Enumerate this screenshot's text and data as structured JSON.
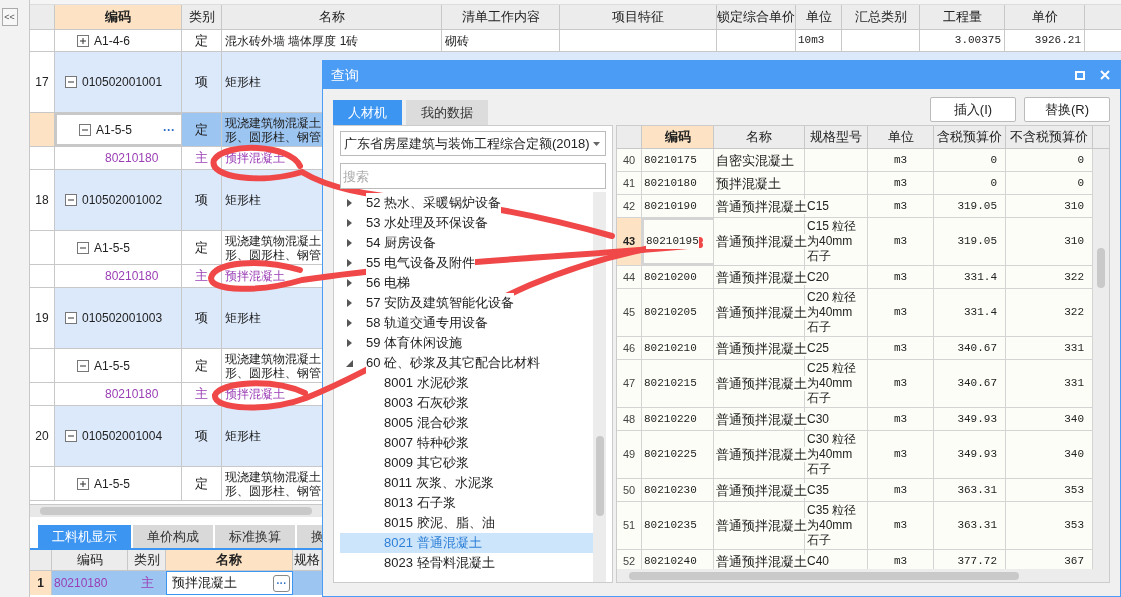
{
  "sidebar_toggle": "<<",
  "main_table": {
    "columns": [
      {
        "label": "编码",
        "selected": true
      },
      {
        "label": "类别",
        "selected": false
      },
      {
        "label": "名称",
        "selected": false
      },
      {
        "label": "清单工作内容",
        "selected": false
      },
      {
        "label": "项目特征",
        "selected": false
      },
      {
        "label": "锁定综合单价",
        "selected": false
      },
      {
        "label": "单位",
        "selected": false
      },
      {
        "label": "汇总类别",
        "selected": false
      },
      {
        "label": "工程量",
        "selected": false
      },
      {
        "label": "单价",
        "selected": false
      }
    ],
    "top_row": {
      "code": "A1-4-6",
      "expanded": false,
      "type": "定",
      "name": "混水砖外墙 墙体厚度 1砖",
      "work": "砌砖",
      "unit": "10m3",
      "quantity": "3.00375",
      "price": "3926.21"
    },
    "rows": [
      {
        "num": "17",
        "code": "010502001001",
        "kind": "bill",
        "expanded": true,
        "type": "项",
        "name": [
          "矩形柱"
        ],
        "selected": false,
        "children": [
          {
            "code": "A1-5-5",
            "kind": "quota",
            "expanded": true,
            "type": "定",
            "name": [
              "现浇建筑物混凝土",
              "形、圆形柱、钢管"
            ],
            "selected": true,
            "more": "···",
            "children": [
              {
                "code": "80210180",
                "kind": "material",
                "type": "主",
                "name": [
                  "预拌混凝土"
                ],
                "selected": false
              }
            ]
          }
        ]
      },
      {
        "num": "18",
        "code": "010502001002",
        "kind": "bill",
        "expanded": true,
        "type": "项",
        "name": [
          "矩形柱"
        ],
        "selected": false,
        "children": [
          {
            "code": "A1-5-5",
            "kind": "quota",
            "expanded": true,
            "type": "定",
            "name": [
              "现浇建筑物混凝土",
              "形、圆形柱、钢管"
            ],
            "selected": false,
            "children": [
              {
                "code": "80210180",
                "kind": "material",
                "type": "主",
                "name": [
                  "预拌混凝土"
                ],
                "selected": false
              }
            ]
          }
        ]
      },
      {
        "num": "19",
        "code": "010502001003",
        "kind": "bill",
        "expanded": true,
        "type": "项",
        "name": [
          "矩形柱"
        ],
        "selected": false,
        "children": [
          {
            "code": "A1-5-5",
            "kind": "quota",
            "expanded": true,
            "type": "定",
            "name": [
              "现浇建筑物混凝土",
              "形、圆形柱、钢管"
            ],
            "selected": false,
            "children": [
              {
                "code": "80210180",
                "kind": "material",
                "type": "主",
                "name": [
                  "预拌混凝土"
                ],
                "selected": false
              }
            ]
          }
        ]
      },
      {
        "num": "20",
        "code": "010502001004",
        "kind": "bill",
        "expanded": true,
        "type": "项",
        "name": [
          "矩形柱"
        ],
        "selected": false,
        "children": [
          {
            "code": "A1-5-5",
            "kind": "quota",
            "expanded": false,
            "type": "定",
            "name": [
              "现浇建筑物混凝土",
              "形、圆形柱、钢管"
            ],
            "selected": false
          }
        ]
      }
    ]
  },
  "detail_tabs": [
    {
      "label": "工料机显示",
      "selected": true
    },
    {
      "label": "单价构成",
      "selected": false
    },
    {
      "label": "标准换算",
      "selected": false
    },
    {
      "label": "换",
      "selected": false
    }
  ],
  "detail_table": {
    "columns": [
      {
        "label": "编码",
        "selected": false
      },
      {
        "label": "类别",
        "selected": false
      },
      {
        "label": "名称",
        "selected": true
      },
      {
        "label": "规格",
        "selected": false
      }
    ],
    "rows": [
      {
        "num": "1",
        "code": "80210180",
        "type": "主",
        "name": "预拌混凝土",
        "more": "···",
        "selected": true
      }
    ]
  },
  "dialog": {
    "title": "查询",
    "tabs": [
      {
        "label": "人材机",
        "selected": true
      },
      {
        "label": "我的数据",
        "selected": false
      }
    ],
    "buttons": [
      "插入(I)",
      "替换(R)"
    ],
    "quota_book": "广东省房屋建筑与装饰工程综合定额(2018)",
    "search_placeholder": "搜索",
    "tree": [
      {
        "label": "52 热水、采暖锅炉设备",
        "expanded": false,
        "selected": false
      },
      {
        "label": "53 水处理及环保设备",
        "expanded": false,
        "selected": false
      },
      {
        "label": "54 厨房设备",
        "expanded": false,
        "selected": false
      },
      {
        "label": "55 电气设备及附件",
        "expanded": false,
        "selected": false
      },
      {
        "label": "56 电梯",
        "expanded": false,
        "selected": false
      },
      {
        "label": "57 安防及建筑智能化设备",
        "expanded": false,
        "selected": false
      },
      {
        "label": "58 轨道交通专用设备",
        "expanded": false,
        "selected": false
      },
      {
        "label": "59 体育休闲设施",
        "expanded": false,
        "selected": false
      },
      {
        "label": "60 砼、砂浆及其它配合比材料",
        "expanded": true,
        "selected": false,
        "children": [
          {
            "label": "8001 水泥砂浆",
            "selected": false
          },
          {
            "label": "8003 石灰砂浆",
            "selected": false
          },
          {
            "label": "8005 混合砂浆",
            "selected": false
          },
          {
            "label": "8007 特种砂浆",
            "selected": false
          },
          {
            "label": "8009 其它砂浆",
            "selected": false
          },
          {
            "label": "8011 灰浆、水泥浆",
            "selected": false
          },
          {
            "label": "8013 石子浆",
            "selected": false
          },
          {
            "label": "8015 胶泥、脂、油",
            "selected": false
          },
          {
            "label": "8021 普通混凝土",
            "selected": true
          },
          {
            "label": "8023 轻骨料混凝土",
            "selected": false
          }
        ]
      }
    ],
    "grid": {
      "columns": [
        {
          "label": "编码",
          "selected": true
        },
        {
          "label": "名称",
          "selected": false
        },
        {
          "label": "规格型号",
          "selected": false
        },
        {
          "label": "单位",
          "selected": false
        },
        {
          "label": "含税预算价",
          "selected": false
        },
        {
          "label": "不含税预算价",
          "selected": false
        }
      ],
      "rows": [
        {
          "num": "40",
          "code": "80210175",
          "name": "自密实混凝土",
          "unit": "m3",
          "tax_price": "0",
          "price": "0",
          "selected": false
        },
        {
          "num": "41",
          "code": "80210180",
          "name": "预拌混凝土",
          "unit": "m3",
          "tax_price": "0",
          "price": "0",
          "selected": false
        },
        {
          "num": "42",
          "code": "80210190",
          "name": "普通预拌混凝土",
          "spec": "C15",
          "unit": "m3",
          "tax_price": "319.05",
          "price": "310",
          "selected": false
        },
        {
          "num": "43",
          "code": "80210195",
          "name": "普通预拌混凝土",
          "spec": "C15 粒径为40mm石子",
          "unit": "m3",
          "tax_price": "319.05",
          "price": "310",
          "selected": true
        },
        {
          "num": "44",
          "code": "80210200",
          "name": "普通预拌混凝土",
          "spec": "C20",
          "unit": "m3",
          "tax_price": "331.4",
          "price": "322",
          "selected": false
        },
        {
          "num": "45",
          "code": "80210205",
          "name": "普通预拌混凝土",
          "spec": "C20 粒径为40mm石子",
          "unit": "m3",
          "tax_price": "331.4",
          "price": "322",
          "selected": false
        },
        {
          "num": "46",
          "code": "80210210",
          "name": "普通预拌混凝土",
          "spec": "C25",
          "unit": "m3",
          "tax_price": "340.67",
          "price": "331",
          "selected": false
        },
        {
          "num": "47",
          "code": "80210215",
          "name": "普通预拌混凝土",
          "spec": "C25 粒径为40mm石子",
          "unit": "m3",
          "tax_price": "340.67",
          "price": "331",
          "selected": false
        },
        {
          "num": "48",
          "code": "80210220",
          "name": "普通预拌混凝土",
          "spec": "C30",
          "unit": "m3",
          "tax_price": "349.93",
          "price": "340",
          "selected": false
        },
        {
          "num": "49",
          "code": "80210225",
          "name": "普通预拌混凝土",
          "spec": "C30 粒径为40mm石子",
          "unit": "m3",
          "tax_price": "349.93",
          "price": "340",
          "selected": false
        },
        {
          "num": "50",
          "code": "80210230",
          "name": "普通预拌混凝土",
          "spec": "C35",
          "unit": "m3",
          "tax_price": "363.31",
          "price": "353",
          "selected": false
        },
        {
          "num": "51",
          "code": "80210235",
          "name": "普通预拌混凝土",
          "spec": "C35 粒径为40mm石子",
          "unit": "m3",
          "tax_price": "363.31",
          "price": "353",
          "selected": false
        },
        {
          "num": "52",
          "code": "80210240",
          "name": "普通预拌混凝土",
          "spec": "C40",
          "unit": "m3",
          "tax_price": "377.72",
          "price": "367",
          "selected": false
        }
      ]
    }
  }
}
